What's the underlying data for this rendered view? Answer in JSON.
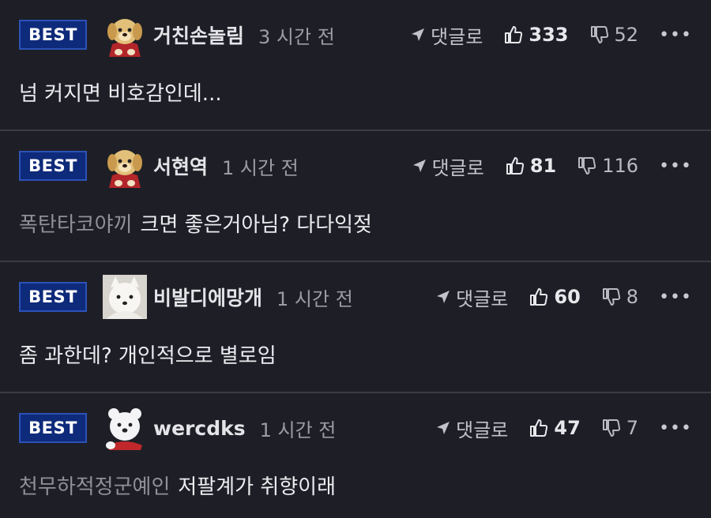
{
  "comments": [
    {
      "badge": "BEST",
      "avatar": "puppy-avatar",
      "nickname": "거친손놀림",
      "time": "3 시간 전",
      "reply_label": "댓글로",
      "likes": "333",
      "dislikes": "52",
      "mention": "",
      "text": "넘 커지면 비호감인데..."
    },
    {
      "badge": "BEST",
      "avatar": "puppy-avatar",
      "nickname": "서현역",
      "time": "1 시간 전",
      "reply_label": "댓글로",
      "likes": "81",
      "dislikes": "116",
      "mention": "폭탄타코야끼",
      "text": "크면 좋은거아님? 다다익젖"
    },
    {
      "badge": "BEST",
      "avatar": "white-dog-avatar",
      "nickname": "비발디에망개",
      "time": "1 시간 전",
      "reply_label": "댓글로",
      "likes": "60",
      "dislikes": "8",
      "mention": "",
      "text": "좀 과한데? 개인적으로 별로임"
    },
    {
      "badge": "BEST",
      "avatar": "polar-bear-avatar",
      "nickname": "wercdks",
      "time": "1 시간 전",
      "reply_label": "댓글로",
      "likes": "47",
      "dislikes": "7",
      "mention": "천무하적정군예인",
      "text": "저팔계가 취향이래"
    }
  ],
  "more_icon": "ellipsis-icon",
  "colors": {
    "background": "#1e1f26",
    "badge_bg": "#0e2a7a",
    "badge_border": "#2c52b8",
    "divider": "#3a3b44"
  }
}
